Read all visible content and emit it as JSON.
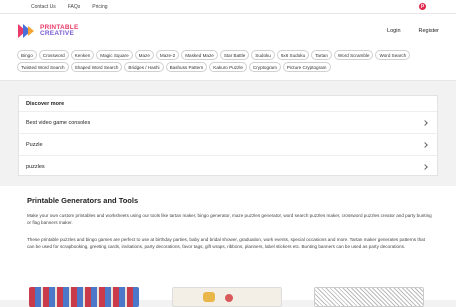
{
  "topbar": {
    "links": [
      "Contact Us",
      "FAQs",
      "Pricing"
    ],
    "pinterest_icon": "pinterest-icon"
  },
  "header": {
    "logo_line1": "PRINTABLE",
    "logo_line2": "CREATIVE",
    "login": "Login",
    "register": "Register"
  },
  "tags": [
    "Bingo",
    "Crossword",
    "Kenken",
    "Magic Square",
    "Maze",
    "Maze-2",
    "Masked Maze",
    "Star Battle",
    "Sudoku",
    "6x6 Sudoku",
    "Tartan",
    "Word Scramble",
    "Word Search",
    "Twisted Word Search",
    "Shaped Word Search",
    "Bridges / Hashi",
    "Bashuss Pattern",
    "Kakuro Puzzle",
    "Cryptogram",
    "Picture Cryptogram"
  ],
  "discover": {
    "title": "Discover more",
    "items": [
      "Best video game consoles",
      "Puzzle",
      "puzzles"
    ]
  },
  "content": {
    "heading": "Printable Generators and Tools",
    "p1": "Make your own custom printables and worksheets using our tools like tartan maker, bingo generator, maze puzzles generator, word search puzzles maker, crossword puzzles creator and party bunting or flag banners maker.",
    "p2": "These printable puzzles and bingo games are perfect to use at birthday parties, baby and bridal shower, graduation, work events, special occasions and more. Tartan maker generates patterns that can be used for scrapbooking, greeting cards, invitations, party decorations, favor tags, gift wraps, ribbons, planners, label stickers etc. Bunting banners can be used as party decorations."
  }
}
